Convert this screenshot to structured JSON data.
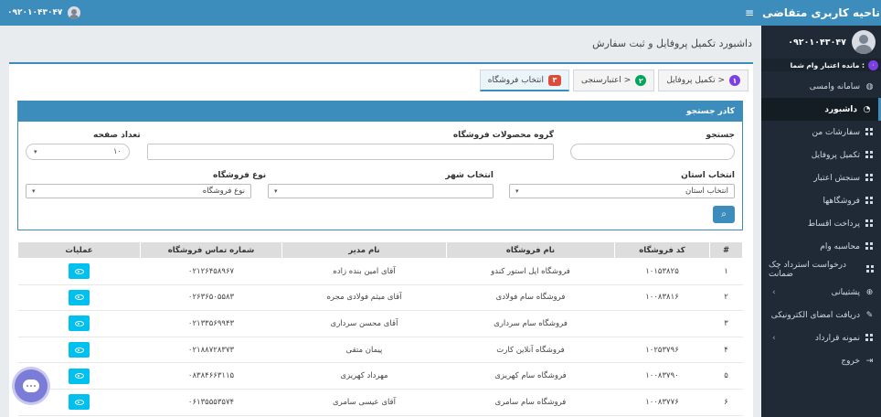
{
  "sidebar": {
    "brand": "ناحیه کاربری متقاضی",
    "user_phone": "۰۹۲۰۱۰۴۳۰۴۷",
    "credit_label": "مانده اعتبار وام شما :",
    "credit_badge": "۰",
    "items": [
      {
        "label": "سامانه وامسی",
        "icon": "vamsi-icon"
      },
      {
        "label": "داشبورد",
        "icon": "dashboard-icon"
      },
      {
        "label": "سفارشات من",
        "icon": "grid-icon"
      },
      {
        "label": "تکمیل پروفایل",
        "icon": "grid-icon"
      },
      {
        "label": "سنجش اعتبار",
        "icon": "grid-icon"
      },
      {
        "label": "فروشگاهها",
        "icon": "grid-icon"
      },
      {
        "label": "پرداخت اقساط",
        "icon": "grid-icon"
      },
      {
        "label": "محاسبه وام",
        "icon": "grid-icon"
      },
      {
        "label": "درخواست استرداد چک ضمانت",
        "icon": "grid-icon"
      },
      {
        "label": "پشتیبانی",
        "icon": "globe-icon"
      },
      {
        "label": "دریافت امضای الکترونیکی",
        "icon": "edit-icon"
      },
      {
        "label": "نمونه قرارداد",
        "icon": "grid-icon"
      },
      {
        "label": "خروج",
        "icon": "logout-icon"
      }
    ]
  },
  "topbar": {
    "user_phone": "۰۹۲۰۱۰۴۳۰۴۷",
    "menu_icon": "≡"
  },
  "page": {
    "title": "داشبورد تکمیل پروفایل و ثبت سفارش"
  },
  "tabs": [
    {
      "num": "۱",
      "label": "تکمیل پروفایل >"
    },
    {
      "num": "۲",
      "label": "اعتبارسنجی >"
    },
    {
      "num": "۳",
      "label": "انتخاب فروشگاه"
    }
  ],
  "search": {
    "title": "کادر جستجو",
    "search_label": "جستجو",
    "group_label": "گروه محصولات فروشگاه",
    "page_size_label": "تعداد صفحه",
    "page_size_value": "۱۰",
    "province_label": "انتخاب استان",
    "province_value": "انتخاب استان",
    "city_label": "انتخاب شهر",
    "city_value": "",
    "store_type_label": "نوع فروشگاه",
    "store_type_value": "نوع فروشگاه"
  },
  "table": {
    "headers": [
      "#",
      "کد فروشگاه",
      "نام فروشگاه",
      "نام مدیر",
      "شماره تماس فروشگاه",
      "عملیات"
    ],
    "rows": [
      [
        "۱",
        "۱۰۱۵۳۸۲۵",
        "فروشگاه اپل استور کندو",
        "آقای امین بنده زاده",
        "۰۲۱۲۶۴۵۸۹۶۷"
      ],
      [
        "۲",
        "۱۰۰۸۳۸۱۶",
        "فروشگاه سام فولادی",
        "آقای میثم فولادی مجره",
        "۰۲۶۳۶۵۰۵۵۸۳"
      ],
      [
        "۳",
        "",
        "فروشگاه سام سرداری",
        "آقای محسن سرداری",
        "۰۲۱۳۳۵۶۹۹۴۳"
      ],
      [
        "۴",
        "۱۰۲۵۳۷۹۶",
        "فروشگاه آنلاین کارت",
        "پیمان متقی",
        "۰۲۱۸۸۷۲۸۳۷۳"
      ],
      [
        "۵",
        "۱۰۰۸۳۷۹۰",
        "فروشگاه سام کهریزی",
        "مهرداد کهریزی",
        "۰۸۳۸۴۶۶۳۱۱۵"
      ],
      [
        "۶",
        "۱۰۰۸۳۷۷۶",
        "فروشگاه سام سامری",
        "آقای عیسی سامری",
        "۰۶۱۳۵۵۵۳۵۷۴"
      ]
    ]
  },
  "colors": {
    "primary": "#3c8dbc",
    "sidebar": "#1f2a36",
    "info": "#00c0ef"
  }
}
